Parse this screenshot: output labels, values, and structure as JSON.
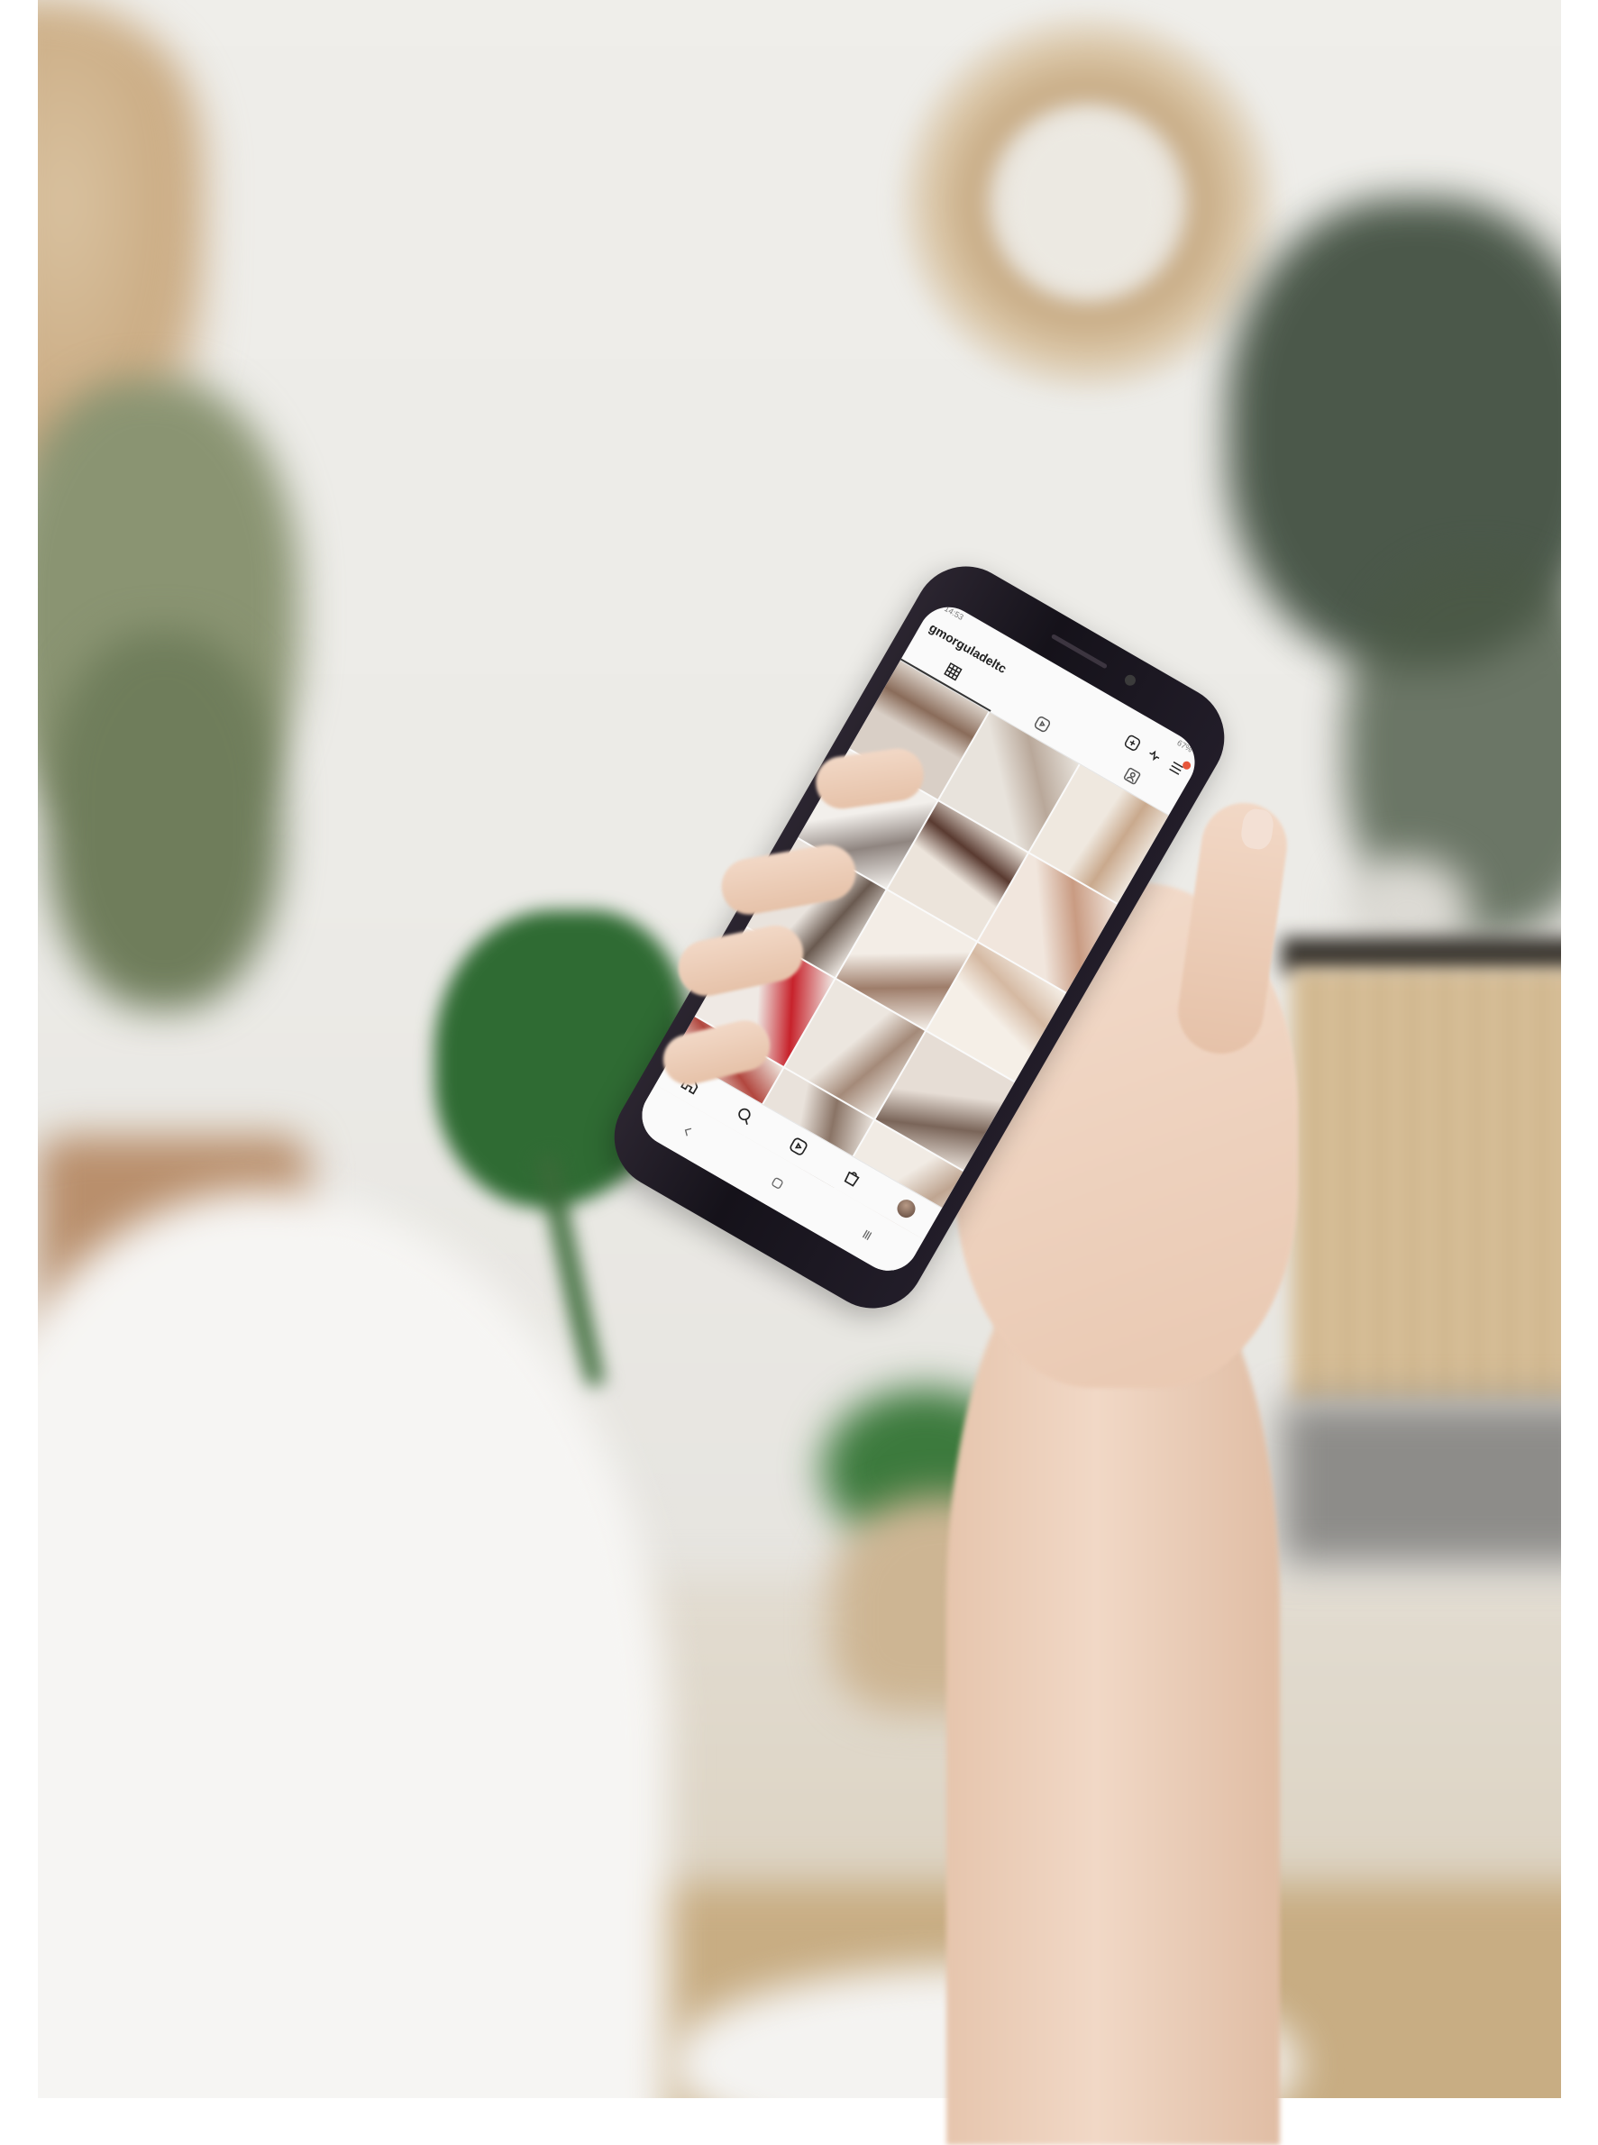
{
  "scene": {
    "description_hidden": "",
    "colors": {
      "wall": "#efeeea",
      "monstera": "#2f6b33",
      "skin": "#f1d8c6",
      "phone_body": "#15121a"
    }
  },
  "phone": {
    "status_bar": {
      "time": "14:53",
      "battery": "67%"
    },
    "header": {
      "username": "gmorguladeltc"
    },
    "icons": {
      "add": "add-post-icon",
      "activity": "activity-icon",
      "menu": "menu-icon",
      "grid_tab": "grid-tab-icon",
      "reels_tab": "reels-tab-icon",
      "tagged_tab": "tagged-tab-icon",
      "home": "home-icon",
      "search": "search-icon",
      "reels": "reels-icon",
      "shop": "shop-icon",
      "profile": "profile-avatar",
      "back": "back-icon",
      "home_sys": "system-home-icon",
      "recents": "recents-icon"
    },
    "grid_tiles": [
      {
        "c1": "#d9cfc6",
        "c2": "#8a6c5a"
      },
      {
        "c1": "#e8e3dc",
        "c2": "#b9a89a"
      },
      {
        "c1": "#efe8df",
        "c2": "#c9a98d"
      },
      {
        "c1": "#f2efeb",
        "c2": "#8f8580"
      },
      {
        "c1": "#ece4db",
        "c2": "#5a3b31"
      },
      {
        "c1": "#f1e6dd",
        "c2": "#c99b82"
      },
      {
        "c1": "#e9e3dd",
        "c2": "#6a5a50"
      },
      {
        "c1": "#f3ede6",
        "c2": "#9e7d6a"
      },
      {
        "c1": "#f5efe7",
        "c2": "#d5b9a2"
      },
      {
        "c1": "#efe9e4",
        "c2": "#c7222b"
      },
      {
        "c1": "#ece6df",
        "c2": "#a48a79"
      },
      {
        "c1": "#e6ddd5",
        "c2": "#7a6559"
      },
      {
        "c1": "#efe7df",
        "c2": "#b2473f"
      },
      {
        "c1": "#e9e2db",
        "c2": "#8a7466"
      },
      {
        "c1": "#f1ebe4",
        "c2": "#bfa591"
      }
    ]
  }
}
